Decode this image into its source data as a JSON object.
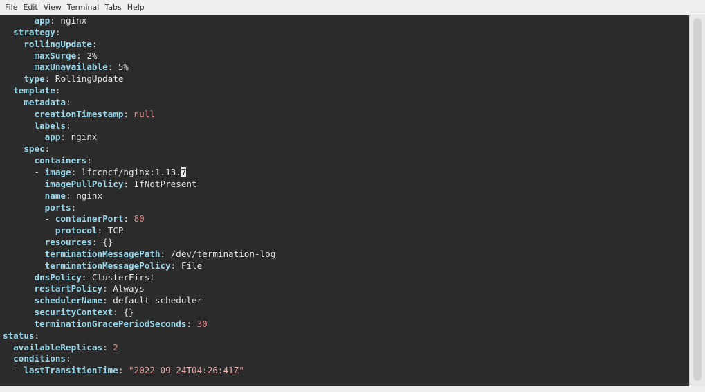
{
  "menu": [
    "File",
    "Edit",
    "View",
    "Terminal",
    "Tabs",
    "Help"
  ],
  "colors": {
    "terminal_bg": "#2b2b2b",
    "key": "#9ad9ec",
    "value": "#e4e4e4",
    "number": "#e68e8e",
    "string": "#e9b0b0"
  },
  "lines": [
    {
      "indent": "      ",
      "dash": "",
      "key": "app",
      "value": "nginx",
      "type": "v"
    },
    {
      "indent": "  ",
      "dash": "",
      "key": "strategy",
      "value": "",
      "type": "v"
    },
    {
      "indent": "    ",
      "dash": "",
      "key": "rollingUpdate",
      "value": "",
      "type": "v"
    },
    {
      "indent": "      ",
      "dash": "",
      "key": "maxSurge",
      "value": "2%",
      "type": "v"
    },
    {
      "indent": "      ",
      "dash": "",
      "key": "maxUnavailable",
      "value": "5%",
      "type": "v"
    },
    {
      "indent": "    ",
      "dash": "",
      "key": "type",
      "value": "RollingUpdate",
      "type": "v"
    },
    {
      "indent": "  ",
      "dash": "",
      "key": "template",
      "value": "",
      "type": "v"
    },
    {
      "indent": "    ",
      "dash": "",
      "key": "metadata",
      "value": "",
      "type": "v"
    },
    {
      "indent": "      ",
      "dash": "",
      "key": "creationTimestamp",
      "value": "null",
      "type": "n"
    },
    {
      "indent": "      ",
      "dash": "",
      "key": "labels",
      "value": "",
      "type": "v"
    },
    {
      "indent": "        ",
      "dash": "",
      "key": "app",
      "value": "nginx",
      "type": "v"
    },
    {
      "indent": "    ",
      "dash": "",
      "key": "spec",
      "value": "",
      "type": "v"
    },
    {
      "indent": "      ",
      "dash": "",
      "key": "containers",
      "value": "",
      "type": "v"
    },
    {
      "indent": "      ",
      "dash": "- ",
      "key": "image",
      "value": "lfccncf/nginx:1.13.",
      "cursor": "7",
      "type": "v"
    },
    {
      "indent": "        ",
      "dash": "",
      "key": "imagePullPolicy",
      "value": "IfNotPresent",
      "type": "v"
    },
    {
      "indent": "        ",
      "dash": "",
      "key": "name",
      "value": "nginx",
      "type": "v"
    },
    {
      "indent": "        ",
      "dash": "",
      "key": "ports",
      "value": "",
      "type": "v"
    },
    {
      "indent": "        ",
      "dash": "- ",
      "key": "containerPort",
      "value": "80",
      "type": "n"
    },
    {
      "indent": "          ",
      "dash": "",
      "key": "protocol",
      "value": "TCP",
      "type": "v"
    },
    {
      "indent": "        ",
      "dash": "",
      "key": "resources",
      "value": "{}",
      "type": "v"
    },
    {
      "indent": "        ",
      "dash": "",
      "key": "terminationMessagePath",
      "value": "/dev/termination-log",
      "type": "v"
    },
    {
      "indent": "        ",
      "dash": "",
      "key": "terminationMessagePolicy",
      "value": "File",
      "type": "v"
    },
    {
      "indent": "      ",
      "dash": "",
      "key": "dnsPolicy",
      "value": "ClusterFirst",
      "type": "v"
    },
    {
      "indent": "      ",
      "dash": "",
      "key": "restartPolicy",
      "value": "Always",
      "type": "v"
    },
    {
      "indent": "      ",
      "dash": "",
      "key": "schedulerName",
      "value": "default-scheduler",
      "type": "v"
    },
    {
      "indent": "      ",
      "dash": "",
      "key": "securityContext",
      "value": "{}",
      "type": "v"
    },
    {
      "indent": "      ",
      "dash": "",
      "key": "terminationGracePeriodSeconds",
      "value": "30",
      "type": "n"
    },
    {
      "indent": "",
      "dash": "",
      "key": "status",
      "value": "",
      "type": "v"
    },
    {
      "indent": "  ",
      "dash": "",
      "key": "availableReplicas",
      "value": "2",
      "type": "n"
    },
    {
      "indent": "  ",
      "dash": "",
      "key": "conditions",
      "value": "",
      "type": "v"
    },
    {
      "indent": "  ",
      "dash": "- ",
      "key": "lastTransitionTime",
      "value": "\"2022-09-24T04:26:41Z\"",
      "type": "s"
    }
  ]
}
